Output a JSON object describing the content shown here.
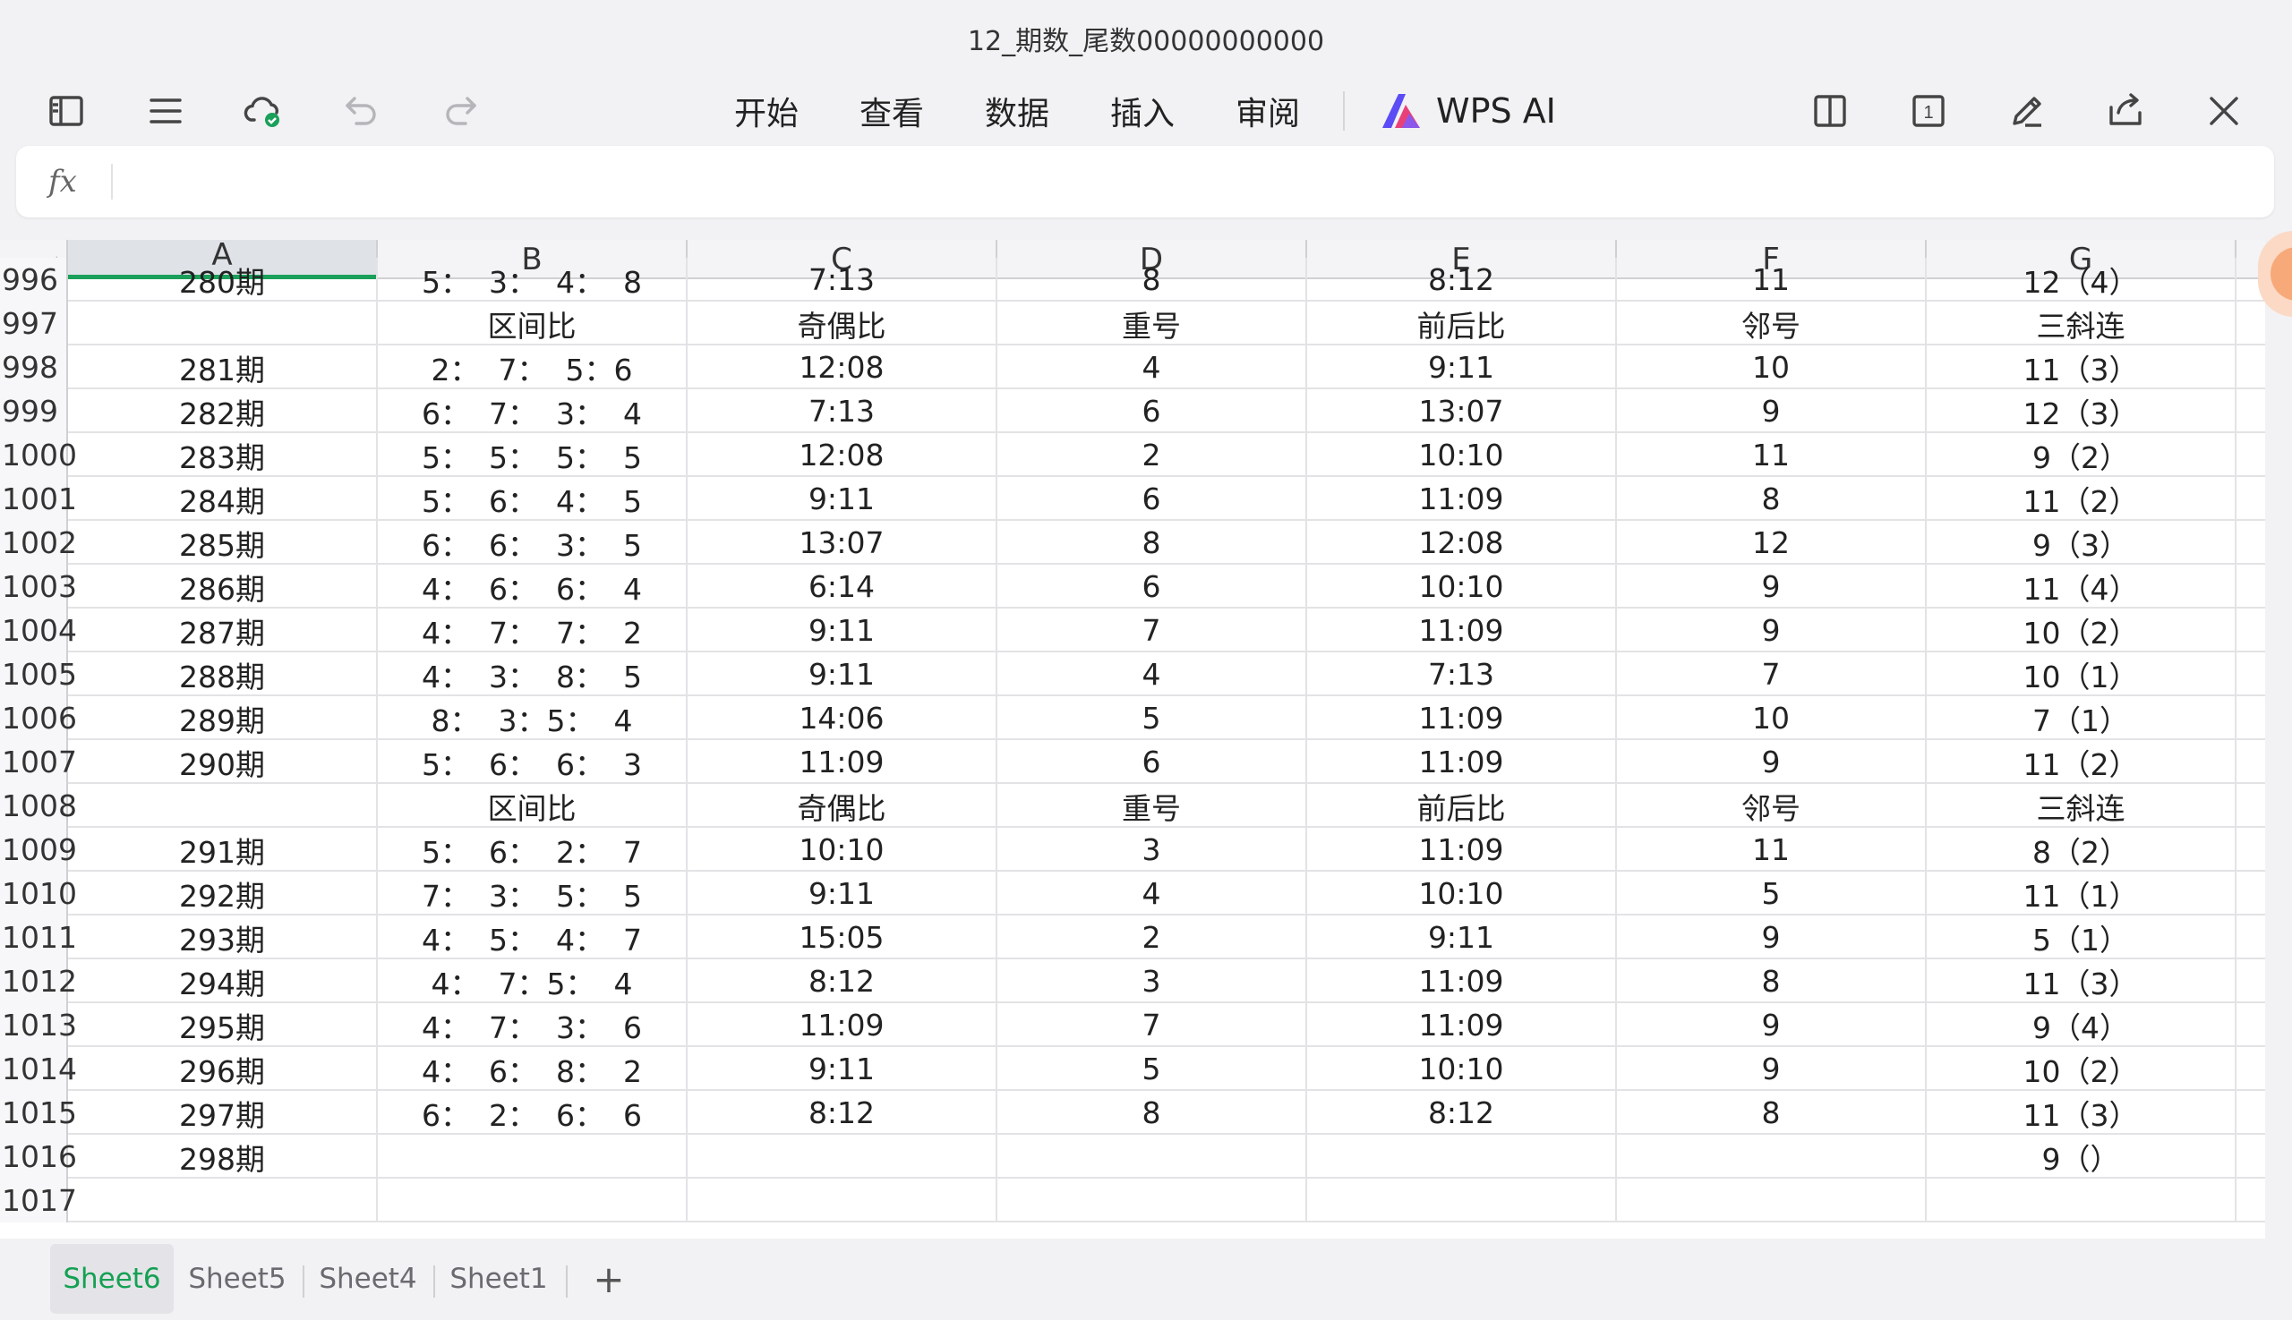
{
  "window": {
    "title": "12_期数_尾数00000000000"
  },
  "toolbar": {
    "menu": [
      "开始",
      "查看",
      "数据",
      "插入",
      "审阅"
    ],
    "ai_label": "WPS AI",
    "page_indicator": "1"
  },
  "formula_bar": {
    "fx_label": "fx",
    "value": ""
  },
  "columns": [
    "A",
    "B",
    "C",
    "D",
    "E",
    "F",
    "G"
  ],
  "rows": [
    {
      "num": "996",
      "cells": [
        "280期",
        "5：  3：  4：  8",
        "7:13",
        "8",
        "8:12",
        "11",
        "12（4）"
      ]
    },
    {
      "num": "997",
      "cells": [
        "",
        "区间比",
        "奇偶比",
        "重号",
        "前后比",
        "邻号",
        "三斜连"
      ]
    },
    {
      "num": "998",
      "cells": [
        "281期",
        "2：  7：  5：6",
        "12:08",
        "4",
        "9:11",
        "10",
        "11（3）"
      ]
    },
    {
      "num": "999",
      "cells": [
        "282期",
        "6：  7：  3：  4",
        "7:13",
        "6",
        "13:07",
        "9",
        "12（3）"
      ]
    },
    {
      "num": "1000",
      "cells": [
        "283期",
        "5：  5：  5：  5",
        "12:08",
        "2",
        "10:10",
        "11",
        "9（2）"
      ]
    },
    {
      "num": "1001",
      "cells": [
        "284期",
        "5：  6：  4：  5",
        "9:11",
        "6",
        "11:09",
        "8",
        "11（2）"
      ]
    },
    {
      "num": "1002",
      "cells": [
        "285期",
        "6：  6：  3：  5",
        "13:07",
        "8",
        "12:08",
        "12",
        "9（3）"
      ]
    },
    {
      "num": "1003",
      "cells": [
        "286期",
        "4：  6：  6：  4",
        "6:14",
        "6",
        "10:10",
        "9",
        "11（4）"
      ]
    },
    {
      "num": "1004",
      "cells": [
        "287期",
        "4：  7：  7：  2",
        "9:11",
        "7",
        "11:09",
        "9",
        "10（2）"
      ]
    },
    {
      "num": "1005",
      "cells": [
        "288期",
        "4：  3：  8：  5",
        "9:11",
        "4",
        "7:13",
        "7",
        "10（1）"
      ]
    },
    {
      "num": "1006",
      "cells": [
        "289期",
        "8：  3：5：  4",
        "14:06",
        "5",
        "11:09",
        "10",
        "7（1）"
      ]
    },
    {
      "num": "1007",
      "cells": [
        "290期",
        "5：  6：  6：  3",
        "11:09",
        "6",
        "11:09",
        "9",
        "11（2）"
      ]
    },
    {
      "num": "1008",
      "cells": [
        "",
        "区间比",
        "奇偶比",
        "重号",
        "前后比",
        "邻号",
        "三斜连"
      ]
    },
    {
      "num": "1009",
      "cells": [
        "291期",
        "5：  6：  2：  7",
        "10:10",
        "3",
        "11:09",
        "11",
        "8（2）"
      ]
    },
    {
      "num": "1010",
      "cells": [
        "292期",
        "7：  3：  5：  5",
        "9:11",
        "4",
        "10:10",
        "5",
        "11（1）"
      ]
    },
    {
      "num": "1011",
      "cells": [
        "293期",
        "4：  5：  4：  7",
        "15:05",
        "2",
        "9:11",
        "9",
        "5（1）"
      ]
    },
    {
      "num": "1012",
      "cells": [
        "294期",
        "4：  7：5：  4",
        "8:12",
        "3",
        "11:09",
        "8",
        "11（3）"
      ]
    },
    {
      "num": "1013",
      "cells": [
        "295期",
        "4：  7：  3：  6",
        "11:09",
        "7",
        "11:09",
        "9",
        "9（4）"
      ]
    },
    {
      "num": "1014",
      "cells": [
        "296期",
        "4：  6：  8：  2",
        "9:11",
        "5",
        "10:10",
        "9",
        "10（2）"
      ]
    },
    {
      "num": "1015",
      "cells": [
        "297期",
        "6：  2：  6：  6",
        "8:12",
        "8",
        "8:12",
        "8",
        "11（3）"
      ]
    },
    {
      "num": "1016",
      "cells": [
        "298期",
        "",
        "",
        "",
        "",
        "",
        "9（）"
      ]
    },
    {
      "num": "1017",
      "cells": [
        "",
        "",
        "",
        "",
        "",
        "",
        ""
      ]
    }
  ],
  "sheet_tabs": [
    "Sheet6",
    "Sheet5",
    "Sheet4",
    "Sheet1"
  ],
  "active_sheet": "Sheet6",
  "add_sheet_label": "+",
  "colors": {
    "accent_green": "#14a053",
    "grid_line": "#e3e3e6"
  },
  "icons": [
    "sidebar-panel-icon",
    "menu-icon",
    "cloud-sync-icon",
    "undo-icon",
    "redo-icon",
    "split-view-icon",
    "page-count-icon",
    "pen-edit-icon",
    "share-icon",
    "close-icon"
  ]
}
